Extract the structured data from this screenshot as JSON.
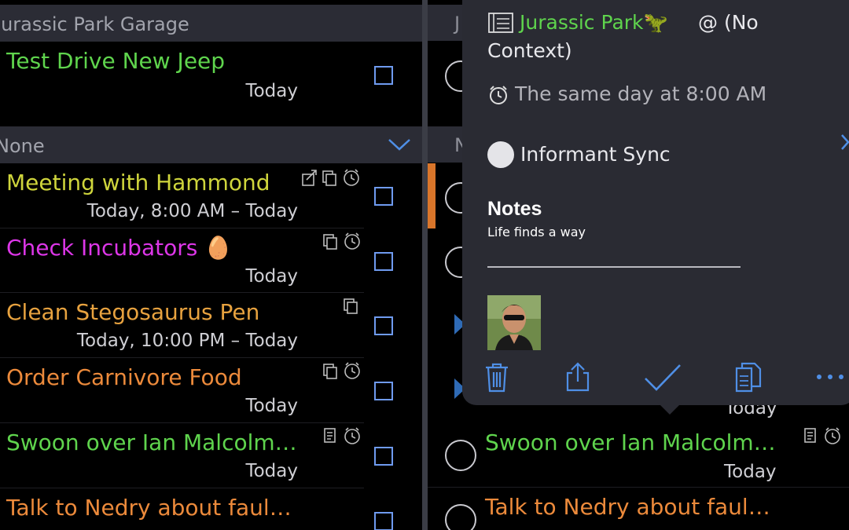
{
  "left": {
    "section1_title": "Jurassic Park Garage",
    "section2_title": "None",
    "tasks": [
      {
        "title": "Test Drive New Jeep",
        "date": "Today"
      },
      {
        "title": "Meeting with Hammond",
        "date": "Today, 8:00 AM – Today"
      },
      {
        "title": "Check Incubators 🥚",
        "date": "Today"
      },
      {
        "title": "Clean Stegosaurus Pen",
        "date": "Today, 10:00 PM – Today"
      },
      {
        "title": "Order Carnivore Food",
        "date": "Today"
      },
      {
        "title": "Swoon over Ian Malcolm…",
        "date": "Today"
      },
      {
        "title": "Talk to Nedry about faul…",
        "date": ""
      }
    ]
  },
  "right": {
    "section1_letter": "J",
    "section2_letter": "N",
    "tasks": [
      {
        "title": "Swoon over Ian Malcolm…",
        "date": "Today"
      },
      {
        "title": "Talk to Nedry about faul…"
      }
    ],
    "hidden_date": "Today"
  },
  "popover": {
    "project": "Jurassic Park🦖",
    "context_line1": "@ (No",
    "context_line2": "Context)",
    "reminder": "The same day at 8:00 AM",
    "sync": "Informant Sync",
    "notes_heading": "Notes",
    "notes_text": "Life finds a way"
  },
  "colors": {
    "green": "#5fd44d",
    "yellow": "#cfd53c",
    "magenta": "#dd36e8",
    "amber": "#e7a23f",
    "orange": "#ec8a3b",
    "checkbox": "#6f9bf0",
    "toolbar": "#4f8fe6",
    "popover_bg": "#2a2b33"
  },
  "icons": [
    "share-icon",
    "copy-icon",
    "alarm-icon",
    "note-icon",
    "trash-icon",
    "checkmark-icon",
    "duplicate-icon",
    "more-icon",
    "project-icon",
    "chevron-down-icon"
  ]
}
